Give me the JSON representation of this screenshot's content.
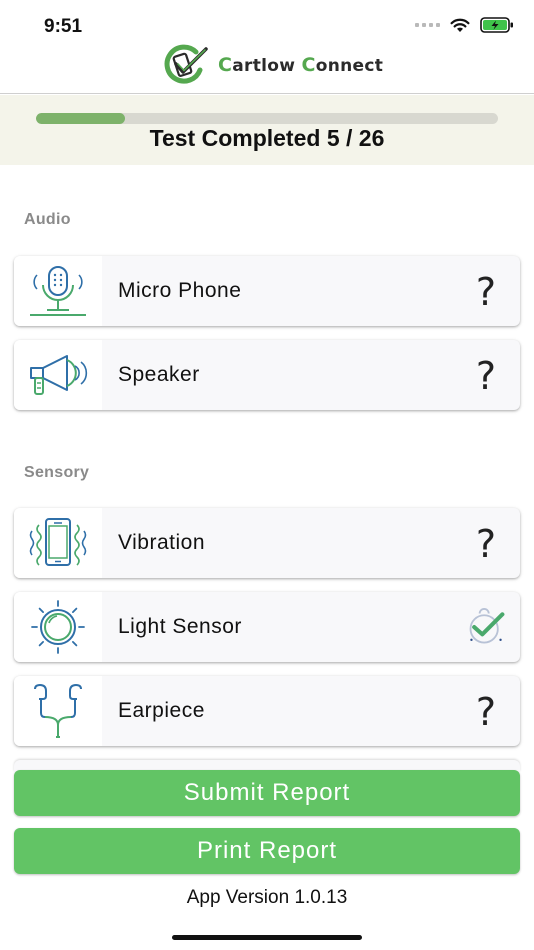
{
  "status_bar": {
    "time": "9:51"
  },
  "header": {
    "logo_word1_initial": "C",
    "logo_word1_rest": "artlow ",
    "logo_word2_initial": "C",
    "logo_word2_rest": "onnect",
    "brand_color": "#55a84f"
  },
  "progress": {
    "label": "Test Completed 5 / 26",
    "completed": 5,
    "total": 26,
    "fill_color": "#7db26a"
  },
  "sections": {
    "audio": {
      "title": "Audio",
      "items": [
        {
          "label": "Micro Phone",
          "icon": "microphone-icon",
          "status": "?"
        },
        {
          "label": "Speaker",
          "icon": "speaker-icon",
          "status": "?"
        }
      ]
    },
    "sensory": {
      "title": "Sensory",
      "items": [
        {
          "label": "Vibration",
          "icon": "vibration-icon",
          "status": "?"
        },
        {
          "label": "Light Sensor",
          "icon": "light-sensor-icon",
          "status": "passed"
        },
        {
          "label": "Earpiece",
          "icon": "earpiece-icon",
          "status": "?"
        }
      ]
    }
  },
  "buttons": {
    "submit": "Submit Report",
    "print": "Print Report",
    "color": "#62c465"
  },
  "footer": {
    "version": "App Version 1.0.13"
  }
}
